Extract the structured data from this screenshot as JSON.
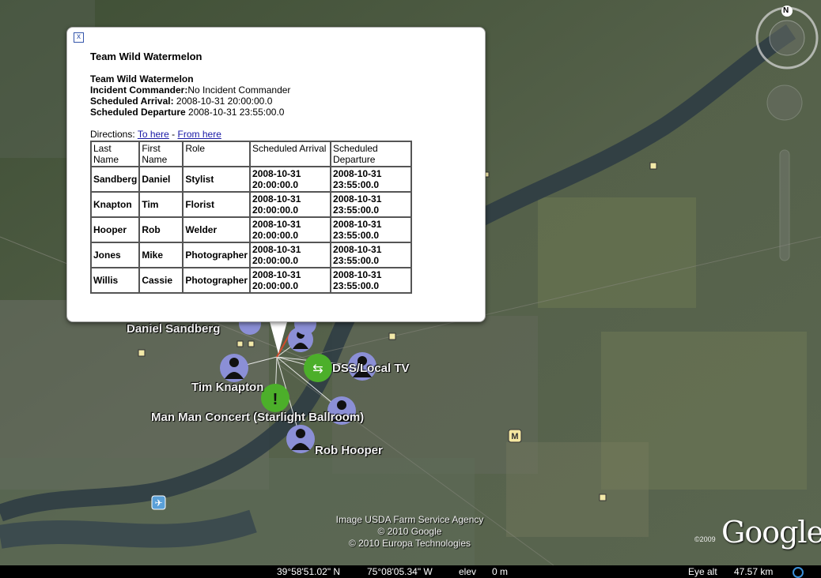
{
  "popup": {
    "title": "Team Wild Watermelon",
    "team_name": "Team Wild Watermelon",
    "incident_commander_label": "Incident Commander:",
    "incident_commander_value": "No Incident Commander",
    "arrival_label": "Scheduled Arrival:",
    "arrival_value": " 2008-10-31 20:00:00.0",
    "departure_label": "Scheduled Departure",
    "departure_value": " 2008-10-31 23:55:00.0",
    "directions_label": "Directions: ",
    "to_here": "To here",
    "separator": " - ",
    "from_here": "From here",
    "close_label": "x",
    "table": {
      "headers": [
        "Last Name",
        "First Name",
        "Role",
        "Scheduled Arrival",
        "Scheduled Departure"
      ],
      "rows": [
        [
          "Sandberg",
          "Daniel",
          "Stylist",
          "2008-10-31 20:00:00.0",
          "2008-10-31 23:55:00.0"
        ],
        [
          "Knapton",
          "Tim",
          "Florist",
          "2008-10-31 20:00:00.0",
          "2008-10-31 23:55:00.0"
        ],
        [
          "Hooper",
          "Rob",
          "Welder",
          "2008-10-31 20:00:00.0",
          "2008-10-31 23:55:00.0"
        ],
        [
          "Jones",
          "Mike",
          "Photographer",
          "2008-10-31 20:00:00.0",
          "2008-10-31 23:55:00.0"
        ],
        [
          "Willis",
          "Cassie",
          "Photographer",
          "2008-10-31 20:00:00.0",
          "2008-10-31 23:55:00.0"
        ]
      ]
    }
  },
  "map_labels": {
    "daniel": "Daniel Sandberg",
    "tim": "Tim Knapton",
    "dss": "DSS/Local TV",
    "concert": "Man Man Concert (Starlight Ballroom)",
    "rob": "Rob Hooper"
  },
  "compass_letter": "N",
  "attribution": {
    "line1": "Image USDA Farm Service Agency",
    "line2": "© 2010 Google",
    "line3": "© 2010 Europa Technologies",
    "year": "©2009",
    "logo": "Google"
  },
  "status": {
    "lat": "39°58'51.02\" N",
    "lon": "75°08'05.34\" W",
    "elev_label": "elev",
    "elev_value": "0 m",
    "eye_label": "Eye alt",
    "eye_value": "47.57 km"
  },
  "colors": {
    "pin_person": "#8b8fd6",
    "pin_green": "#4caf2a",
    "river": "#2f3d44"
  }
}
